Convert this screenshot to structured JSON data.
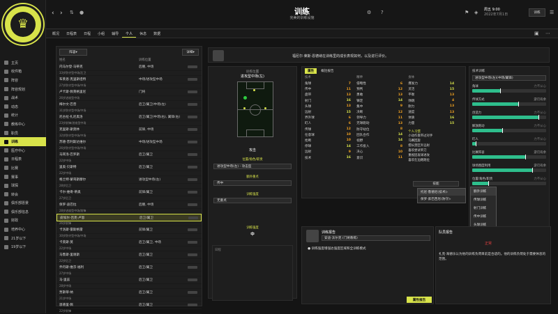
{
  "header": {
    "title": "训练",
    "subtitle": "完美的训练设施",
    "date_day": "周五 9:00",
    "date_full": "2022年7月1日",
    "menu_label": "训练"
  },
  "sidebar": {
    "items": [
      {
        "label": "主页"
      },
      {
        "label": "收件箱"
      },
      {
        "label": "阵容"
      },
      {
        "label": "阵容规划"
      },
      {
        "label": "战术"
      },
      {
        "label": "动态"
      },
      {
        "label": "统计"
      },
      {
        "label": "教练中心"
      },
      {
        "label": "职员"
      },
      {
        "label": "训练"
      },
      {
        "label": "医疗中心"
      },
      {
        "label": "日程表"
      },
      {
        "label": "比赛"
      },
      {
        "label": "赛事"
      },
      {
        "label": "球探"
      },
      {
        "label": "转会"
      },
      {
        "label": "俱乐部愿景"
      },
      {
        "label": "俱乐部信息"
      },
      {
        "label": "财政"
      },
      {
        "label": "培养中心"
      },
      {
        "label": "21岁以下"
      },
      {
        "label": "19岁以下"
      }
    ],
    "active_index": 9
  },
  "tabs": [
    "概况",
    "日程表",
    "日程",
    "小组",
    "辅导",
    "个人",
    "休息",
    "数据"
  ],
  "active_tab": 5,
  "squad": {
    "filter_label": "阵容",
    "view_label": "详细",
    "col_player": "姓名",
    "col_pos": "训练位置",
    "rows": [
      {
        "name": "内马尔登·马蒂克",
        "sub": "33岁防守型中场/后卫",
        "pos": "后腰, 中场"
      },
      {
        "name": "布莱恩·克里斯坦特",
        "sub": "27岁防守型中场/中场",
        "pos": "中场/进攻型中场"
      },
      {
        "name": "卢卡斯·佩莱格里尼",
        "sub": "26岁进攻型中场",
        "pos": "门将"
      },
      {
        "name": "梅尔文·巴普",
        "sub": "31岁防守型中场/中场",
        "pos": "后卫/翼卫/中场(左)"
      },
      {
        "name": "尼古拉·扎尼奥洛",
        "sub": "23岁前锋/进攻型中场",
        "pos": "后卫/翼卫/中场(右), 翼锋(右)"
      },
      {
        "name": "克里斯·斯莫林",
        "sub": "32岁防守型中场/中场",
        "pos": "前锋, 中场"
      },
      {
        "name": "苏德·普利斯达维尔",
        "sub": "26岁防守型中场/中场",
        "pos": "中场/进攻型中场"
      },
      {
        "name": "马耳洛·巴罗斯",
        "sub": "22岁中场",
        "pos": "后卫/翼卫"
      },
      {
        "name": "里奥·贝斯特",
        "sub": "22岁中场",
        "pos": "后卫/翼卫"
      },
      {
        "name": "格兰特·蒙哥斯摩尔",
        "sub": "28岁后卫",
        "pos": "进攻型中场(左)"
      },
      {
        "name": "卡尔·维奇-蒂奥",
        "sub": "27岁后卫",
        "pos": "前锋/翼卫"
      },
      {
        "name": "保罗·迪巴拉",
        "sub": "28岁进攻型中场/前锋",
        "pos": "后腰, 中场"
      },
      {
        "name": "皮埃尔-吕克·卢恩",
        "sub": "26岁前锋",
        "pos": "后卫/翼卫"
      },
      {
        "name": "卡洛斯·雷斯格雷",
        "sub": "30岁防守型中场/中场",
        "pos": "前锋/翼卫"
      },
      {
        "name": "卡莫斯·莫",
        "sub": "22岁中场",
        "pos": "后卫/翼卫, 中场"
      },
      {
        "name": "马鲁斯·里谢斯",
        "sub": "22岁后卫",
        "pos": "后卫/翼卫"
      },
      {
        "name": "乔丹斯·维京·福利",
        "sub": "27岁中场",
        "pos": "后卫/翼卫"
      },
      {
        "name": "马·里兹",
        "sub": "28岁中场",
        "pos": "后卫/翼卫"
      },
      {
        "name": "贾斯蒂·纳",
        "sub": "21岁中场",
        "pos": "后卫/翼卫"
      },
      {
        "name": "恩德里·佩",
        "sub": "22岁前锋",
        "pos": "后卫/翼卫"
      }
    ],
    "selected": 12
  },
  "player": {
    "comment": "福尼尔·莱斯·恩德纳在训练里的成长表现如何，以及进行评价。",
    "panel_title": "训练位置",
    "position": "进攻型中场(左)",
    "role_label": "攻击",
    "role_sub": "位置/角色/职责",
    "role_value": "进攻型中场(左) - 攻击型",
    "focus_title": "额外重点",
    "focus_value": "传中",
    "extra_title": "训练强度",
    "extra_value": "无重点",
    "intensity_title": "训练强度",
    "intensity_value": "中",
    "schedule_label": "日程"
  },
  "attrs": {
    "tab_a": "属性",
    "tab_b": "概括报告",
    "technical_title": "技术",
    "mental_title": "精神",
    "physical_title": "身体",
    "technical": [
      [
        "角球",
        "7"
      ],
      [
        "传中",
        "11"
      ],
      [
        "盘带",
        "13"
      ],
      [
        "射门",
        "16"
      ],
      [
        "头球",
        "13"
      ],
      [
        "远射",
        "15"
      ],
      [
        "界外球",
        "6"
      ],
      [
        "盯人",
        "6"
      ],
      [
        "传球",
        "12"
      ],
      [
        "任意球",
        "10"
      ],
      [
        "抢断",
        "10"
      ],
      [
        "停球",
        "14"
      ],
      [
        "远射",
        "9"
      ],
      [
        "技术",
        "16"
      ]
    ],
    "mental": [
      [
        "侵略性",
        "6"
      ],
      [
        "预判",
        "12"
      ],
      [
        "勇敢",
        "13"
      ],
      [
        "镇定",
        "14"
      ],
      [
        "集中",
        "9"
      ],
      [
        "决断",
        "12"
      ],
      [
        "领导力",
        "11"
      ],
      [
        "无球跑动",
        "13"
      ],
      [
        "防守站位",
        "8"
      ],
      [
        "团队合作",
        "14"
      ],
      [
        "视野",
        "14"
      ],
      [
        "工作投入",
        "8"
      ],
      [
        "决心",
        "10"
      ],
      [
        "意识",
        "11"
      ]
    ],
    "physical": [
      [
        "爆发力",
        "14"
      ],
      [
        "灵活",
        "15"
      ],
      [
        "平衡",
        "13"
      ],
      [
        "弹跳",
        "4"
      ],
      [
        "耐力",
        "13"
      ],
      [
        "速度",
        "13"
      ],
      [
        "体质",
        "16"
      ],
      [
        "力量",
        "15"
      ]
    ],
    "traits_title": "个人习惯",
    "traits": [
      "小动作盘带过对手",
      "马赛回旋",
      "擅长禁区外远射",
      "喜欢尝试单刀",
      "重视因发球进攻",
      "喜欢在边路跑位"
    ],
    "sel_label": "技能",
    "sel_dropdown": "训练重点",
    "sub_menu_a": "托尼·鲁德尼(技术)",
    "sub_menu_b": "保罗·索巴西尼(防守)"
  },
  "right_panel": {
    "title": "技术训练",
    "dropdown_label": "进攻型中场(左)(中场/翼锋)",
    "bars": [
      {
        "label": "角球",
        "level": 0.38,
        "tag": "力不从心"
      },
      {
        "label": "传球方式",
        "level": 0.62,
        "tag": "游刃有余"
      },
      {
        "label": "创造力",
        "level": 0.9,
        "tag": "力不从心"
      },
      {
        "label": "解放跑动",
        "level": 0.41,
        "tag": "力不从心"
      },
      {
        "label": "盯人",
        "level": 0.05,
        "tag": "力不从心"
      },
      {
        "label": "比赛阵容",
        "level": 0.72,
        "tag": "游刃有余"
      },
      {
        "label": "球场围度利用",
        "level": 0.81,
        "tag": "游刃有余"
      },
      {
        "label": "位置/角色/职责",
        "level": 0.22,
        "tag": "力不从心"
      }
    ],
    "menu": [
      "额外训练",
      "传球训练",
      "射门训练",
      "传中训练",
      "头球训练",
      "技术训练"
    ]
  },
  "coach": {
    "title": "训练报告",
    "coach_name": "安迪·沃尔克 (门将教练)",
    "line": "训练强度增强达强度区域和全训练模式",
    "button": "属性报告"
  },
  "feedback": {
    "title": "队员报告",
    "status": "正常",
    "text": "扎克·海德乐认为他的训练负荷目前是合适的。他的训练负荷处于需要休息的范围。"
  }
}
